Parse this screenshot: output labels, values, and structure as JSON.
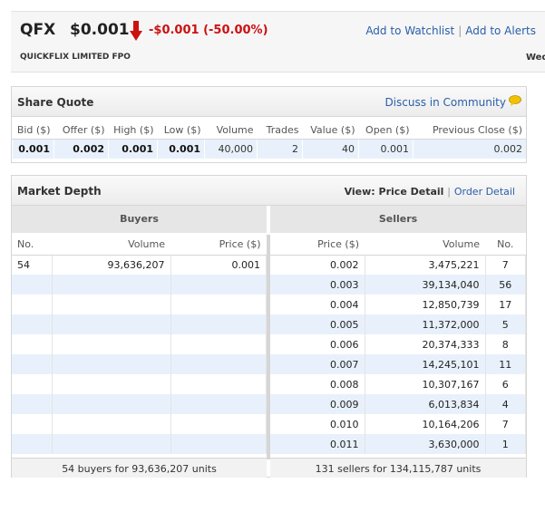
{
  "header": {
    "ticker": "QFX",
    "price": "$0.001",
    "change": "-$0.001 (-50.00%)",
    "company": "QUICKFLIX LIMITED FPO",
    "date_fragment": "Wed",
    "add_watchlist": "Add to Watchlist",
    "add_alerts": "Add to Alerts",
    "change_color": "#cc1111",
    "arrow_icon": "down-arrow-icon"
  },
  "share_quote": {
    "title": "Share Quote",
    "community_link": "Discuss in Community",
    "columns": [
      "Bid ($)",
      "Offer ($)",
      "High ($)",
      "Low ($)",
      "Volume",
      "Trades",
      "Value ($)",
      "Open ($)",
      "Previous Close ($)"
    ],
    "values": [
      "0.001",
      "0.002",
      "0.001",
      "0.001",
      "40,000",
      "2",
      "40",
      "0.001",
      "0.002"
    ]
  },
  "market_depth": {
    "title": "Market Depth",
    "view_label": "View: Price Detail",
    "order_detail_link": "Order Detail",
    "buyers_label": "Buyers",
    "sellers_label": "Sellers",
    "buy_columns": [
      "No.",
      "Volume",
      "Price ($)"
    ],
    "sell_columns": [
      "Price ($)",
      "Volume",
      "No."
    ],
    "buyers": [
      {
        "no": "54",
        "volume": "93,636,207",
        "price": "0.001"
      },
      {
        "no": "",
        "volume": "",
        "price": ""
      },
      {
        "no": "",
        "volume": "",
        "price": ""
      },
      {
        "no": "",
        "volume": "",
        "price": ""
      },
      {
        "no": "",
        "volume": "",
        "price": ""
      },
      {
        "no": "",
        "volume": "",
        "price": ""
      },
      {
        "no": "",
        "volume": "",
        "price": ""
      },
      {
        "no": "",
        "volume": "",
        "price": ""
      },
      {
        "no": "",
        "volume": "",
        "price": ""
      },
      {
        "no": "",
        "volume": "",
        "price": ""
      }
    ],
    "sellers": [
      {
        "price": "0.002",
        "volume": "3,475,221",
        "no": "7"
      },
      {
        "price": "0.003",
        "volume": "39,134,040",
        "no": "56"
      },
      {
        "price": "0.004",
        "volume": "12,850,739",
        "no": "17"
      },
      {
        "price": "0.005",
        "volume": "11,372,000",
        "no": "5"
      },
      {
        "price": "0.006",
        "volume": "20,374,333",
        "no": "8"
      },
      {
        "price": "0.007",
        "volume": "14,245,101",
        "no": "11"
      },
      {
        "price": "0.008",
        "volume": "10,307,167",
        "no": "6"
      },
      {
        "price": "0.009",
        "volume": "6,013,834",
        "no": "4"
      },
      {
        "price": "0.010",
        "volume": "10,164,206",
        "no": "7"
      },
      {
        "price": "0.011",
        "volume": "3,630,000",
        "no": "1"
      }
    ],
    "buyers_summary": "54 buyers for 93,636,207 units",
    "sellers_summary": "131 sellers for 134,115,787 units"
  }
}
